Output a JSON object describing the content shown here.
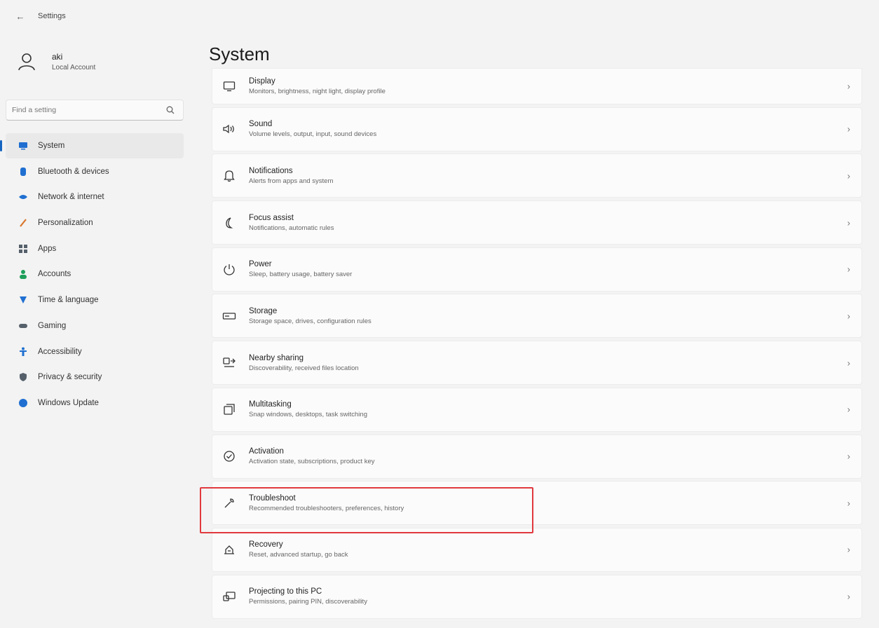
{
  "window": {
    "title": "Settings"
  },
  "account": {
    "name": "aki",
    "type": "Local Account",
    "icon": "person-icon"
  },
  "search": {
    "placeholder": "Find a setting",
    "icon": "search-icon"
  },
  "sidebar": {
    "items": [
      {
        "label": "System",
        "icon": "system-icon",
        "color": "#1f6fd1",
        "active": true
      },
      {
        "label": "Bluetooth & devices",
        "icon": "bluetooth-icon",
        "color": "#1f6fd1"
      },
      {
        "label": "Network & internet",
        "icon": "network-icon",
        "color": "#1f6fd1"
      },
      {
        "label": "Personalization",
        "icon": "brush-icon",
        "color": "#d8752b"
      },
      {
        "label": "Apps",
        "icon": "apps-icon",
        "color": "#55606b"
      },
      {
        "label": "Accounts",
        "icon": "accounts-icon",
        "color": "#1e9e5a"
      },
      {
        "label": "Time & language",
        "icon": "globe-clock-icon",
        "color": "#1f6fd1"
      },
      {
        "label": "Gaming",
        "icon": "gaming-icon",
        "color": "#55606b"
      },
      {
        "label": "Accessibility",
        "icon": "accessibility-icon",
        "color": "#1f6fd1"
      },
      {
        "label": "Privacy & security",
        "icon": "shield-icon",
        "color": "#55606b"
      },
      {
        "label": "Windows Update",
        "icon": "update-icon",
        "color": "#1f6fd1"
      }
    ]
  },
  "main": {
    "title": "System",
    "rows": [
      {
        "title": "Display",
        "desc": "Monitors, brightness, night light, display profile",
        "icon": "display-icon"
      },
      {
        "title": "Sound",
        "desc": "Volume levels, output, input, sound devices",
        "icon": "speaker-icon"
      },
      {
        "title": "Notifications",
        "desc": "Alerts from apps and system",
        "icon": "bell-icon"
      },
      {
        "title": "Focus assist",
        "desc": "Notifications, automatic rules",
        "icon": "moon-icon"
      },
      {
        "title": "Power",
        "desc": "Sleep, battery usage, battery saver",
        "icon": "power-icon"
      },
      {
        "title": "Storage",
        "desc": "Storage space, drives, configuration rules",
        "icon": "storage-icon"
      },
      {
        "title": "Nearby sharing",
        "desc": "Discoverability, received files location",
        "icon": "share-icon"
      },
      {
        "title": "Multitasking",
        "desc": "Snap windows, desktops, task switching",
        "icon": "multitask-icon"
      },
      {
        "title": "Activation",
        "desc": "Activation state, subscriptions, product key",
        "icon": "check-circle-icon"
      },
      {
        "title": "Troubleshoot",
        "desc": "Recommended troubleshooters, preferences, history",
        "icon": "wrench-icon",
        "highlighted": true
      },
      {
        "title": "Recovery",
        "desc": "Reset, advanced startup, go back",
        "icon": "recovery-icon"
      },
      {
        "title": "Projecting to this PC",
        "desc": "Permissions, pairing PIN, discoverability",
        "icon": "project-icon"
      }
    ]
  },
  "colors": {
    "highlight": "#e0393e",
    "accent": "#1565c0"
  }
}
